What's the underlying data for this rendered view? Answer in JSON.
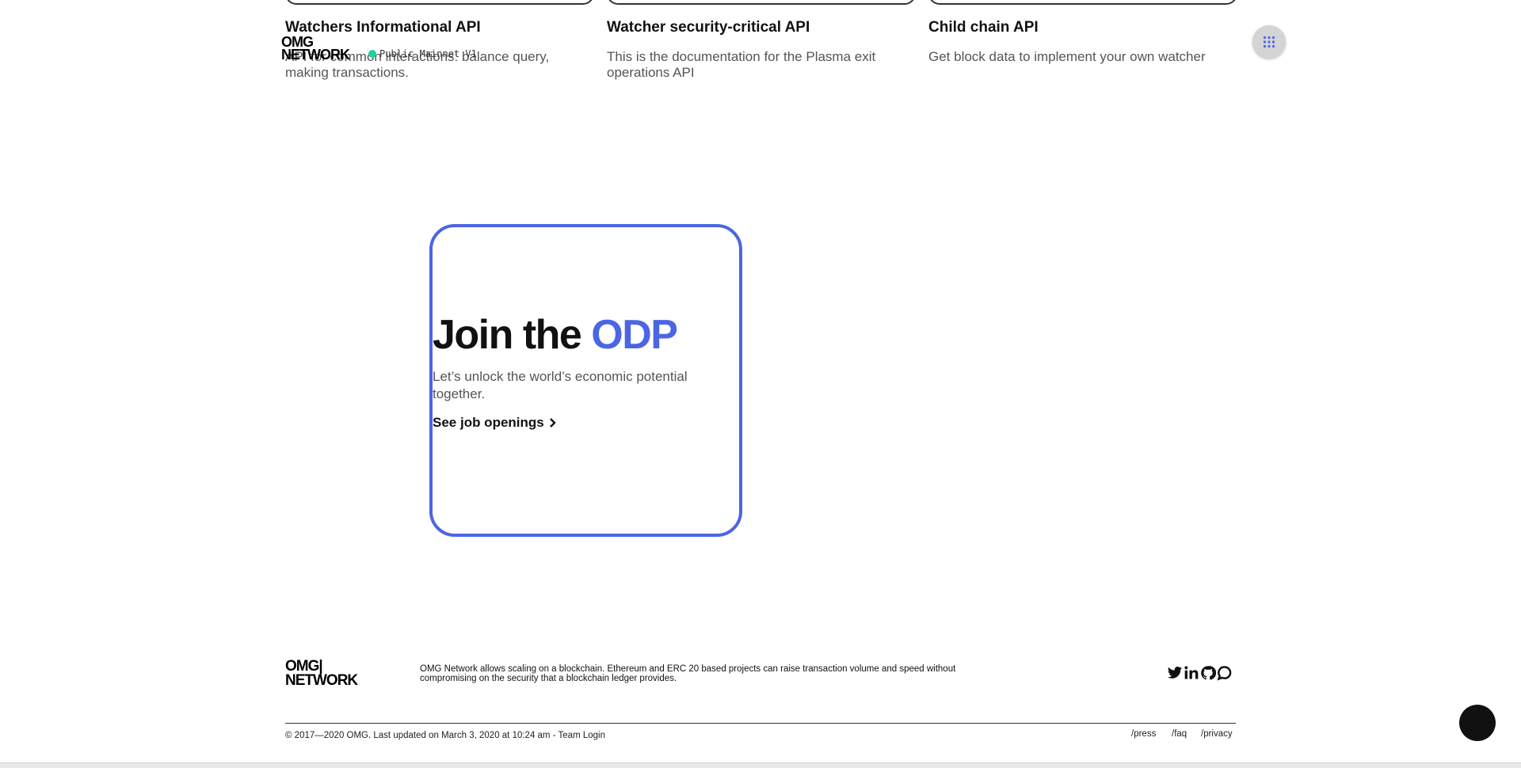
{
  "api_cards": [
    {
      "title": "Watchers Informational API",
      "description": "API for common interactions: balance query, making transactions."
    },
    {
      "title": "Watcher security-critical API",
      "description": "This is the documentation for the Plasma exit operations API"
    },
    {
      "title": "Child chain API",
      "description": "Get block data to implement your own watcher"
    }
  ],
  "header": {
    "logo_line1": "OMG",
    "logo_line2": "NETWORK",
    "network_status": "Public Mainnet V1",
    "status_color": "#1fd1a1",
    "menu_icon": "grid-icon"
  },
  "join": {
    "heading_prefix": "Join the",
    "heading_accent": "ODP",
    "subtitle": "Let’s unlock the world’s economic potential together.",
    "link_label": "See job openings",
    "accent_color": "#4c65e4"
  },
  "footer": {
    "logo_line1": "OMG|",
    "logo_line2": "NETWORK",
    "description": "OMG Network allows scaling on a blockchain. Ethereum and ERC 20 based projects can raise transaction volume and speed without compromising on the security that a blockchain ledger provides.",
    "copyright": "© 2017—2020 OMG. Last updated on March 3, 2020 at 10:24 am - Team Login",
    "links": [
      "/press",
      "/faq",
      "/privacy"
    ],
    "social_icons": [
      "twitter-icon",
      "linkedin-icon",
      "github-icon",
      "chat-icon"
    ]
  }
}
